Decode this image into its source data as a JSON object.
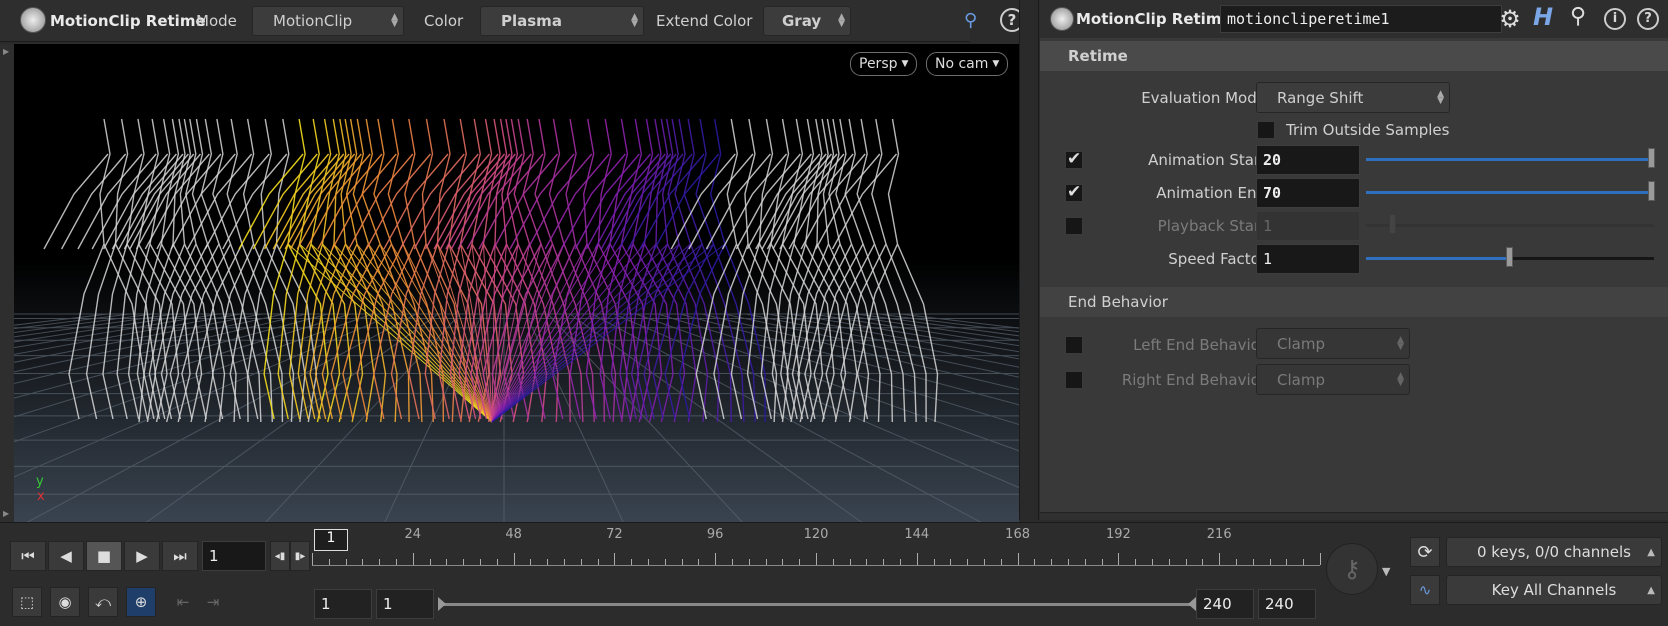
{
  "toolbar": {
    "node_title": "MotionClip Retime",
    "mode_label": "Mode",
    "mode_value": "MotionClip",
    "color_label": "Color",
    "color_value": "Plasma",
    "extend_color_label": "Extend Color",
    "extend_color_value": "Gray",
    "help_icon": "question-icon"
  },
  "viewport": {
    "camera_view": "Persp",
    "camera": "No cam",
    "axis_y": "y",
    "axis_x": "x",
    "colors": {
      "plasma_yellow": "#f5e01e",
      "plasma_orange": "#f08a3a",
      "plasma_pink": "#d0488a",
      "plasma_purple": "#8a1fb0",
      "plasma_blue": "#2a1aa0",
      "gray": "#d8d8d8"
    }
  },
  "params": {
    "node_type": "MotionClip Retime",
    "node_name": "motioncliperetime1",
    "section_retime": "Retime",
    "evaluation_mode_label": "Evaluation Mode",
    "evaluation_mode_value": "Range Shift",
    "trim_label": "Trim Outside Samples",
    "animation_start_label": "Animation Start",
    "animation_start_value": "20",
    "animation_end_label": "Animation End",
    "animation_end_value": "70",
    "playback_start_label": "Playback Start",
    "playback_start_value": "1",
    "speed_factor_label": "Speed Factor",
    "speed_factor_value": "1",
    "section_end": "End Behavior",
    "left_end_label": "Left End Behavior",
    "left_end_value": "Clamp",
    "right_end_label": "Right End Behavior",
    "right_end_value": "Clamp"
  },
  "timeline": {
    "current_frame": "1",
    "frame_marker": "1",
    "ticks": [
      "24",
      "48",
      "72",
      "96",
      "120",
      "144",
      "168",
      "192",
      "216"
    ],
    "range_start": "1",
    "range_start2": "1",
    "range_end": "240",
    "range_end2": "240",
    "keys_status": "0 keys, 0/0 channels",
    "key_channels": "Key All Channels"
  }
}
